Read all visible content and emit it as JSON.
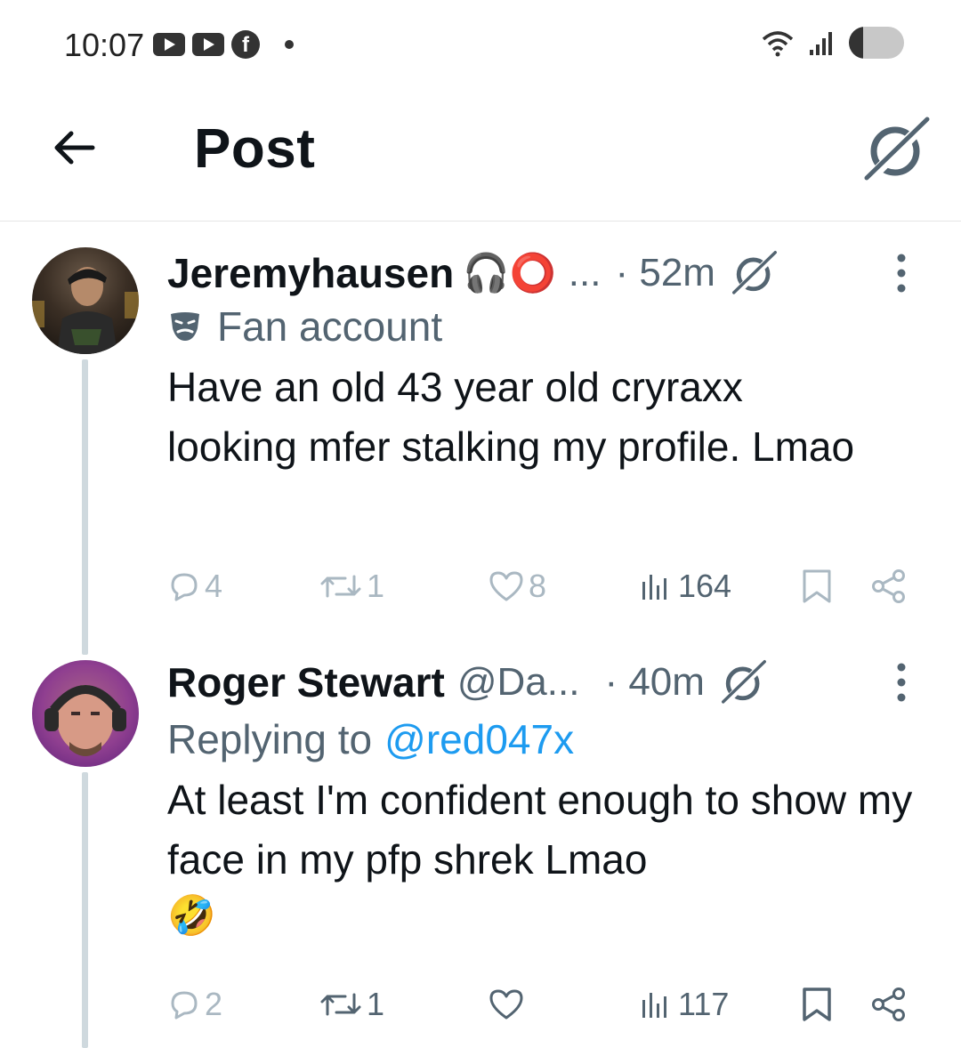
{
  "status_bar": {
    "time": "10:07"
  },
  "header": {
    "title": "Post"
  },
  "tweets": [
    {
      "name": "Jeremyhausen",
      "name_emoji": "🎧⭕",
      "name_truncation": "...",
      "time": "· 52m",
      "subtitle": "Fan account",
      "text": "Have an old 43 year old cryraxx looking mfer stalking my profile. Lmao",
      "replies": "4",
      "reposts": "1",
      "likes": "8",
      "views": "164"
    },
    {
      "name": "Roger Stewart",
      "handle": "@Da...",
      "time": "· 40m",
      "replying_prefix": "Replying to",
      "replying_to": "@red047x",
      "text": "At least I'm confident enough to show my face in my pfp shrek Lmao",
      "emoji": "🤣",
      "replies": "2",
      "reposts": "1",
      "likes": "",
      "views": "117"
    }
  ],
  "colors": {
    "accent": "#1d9bf0",
    "secondary_text": "#536471",
    "thread_line": "#cfd9de"
  }
}
